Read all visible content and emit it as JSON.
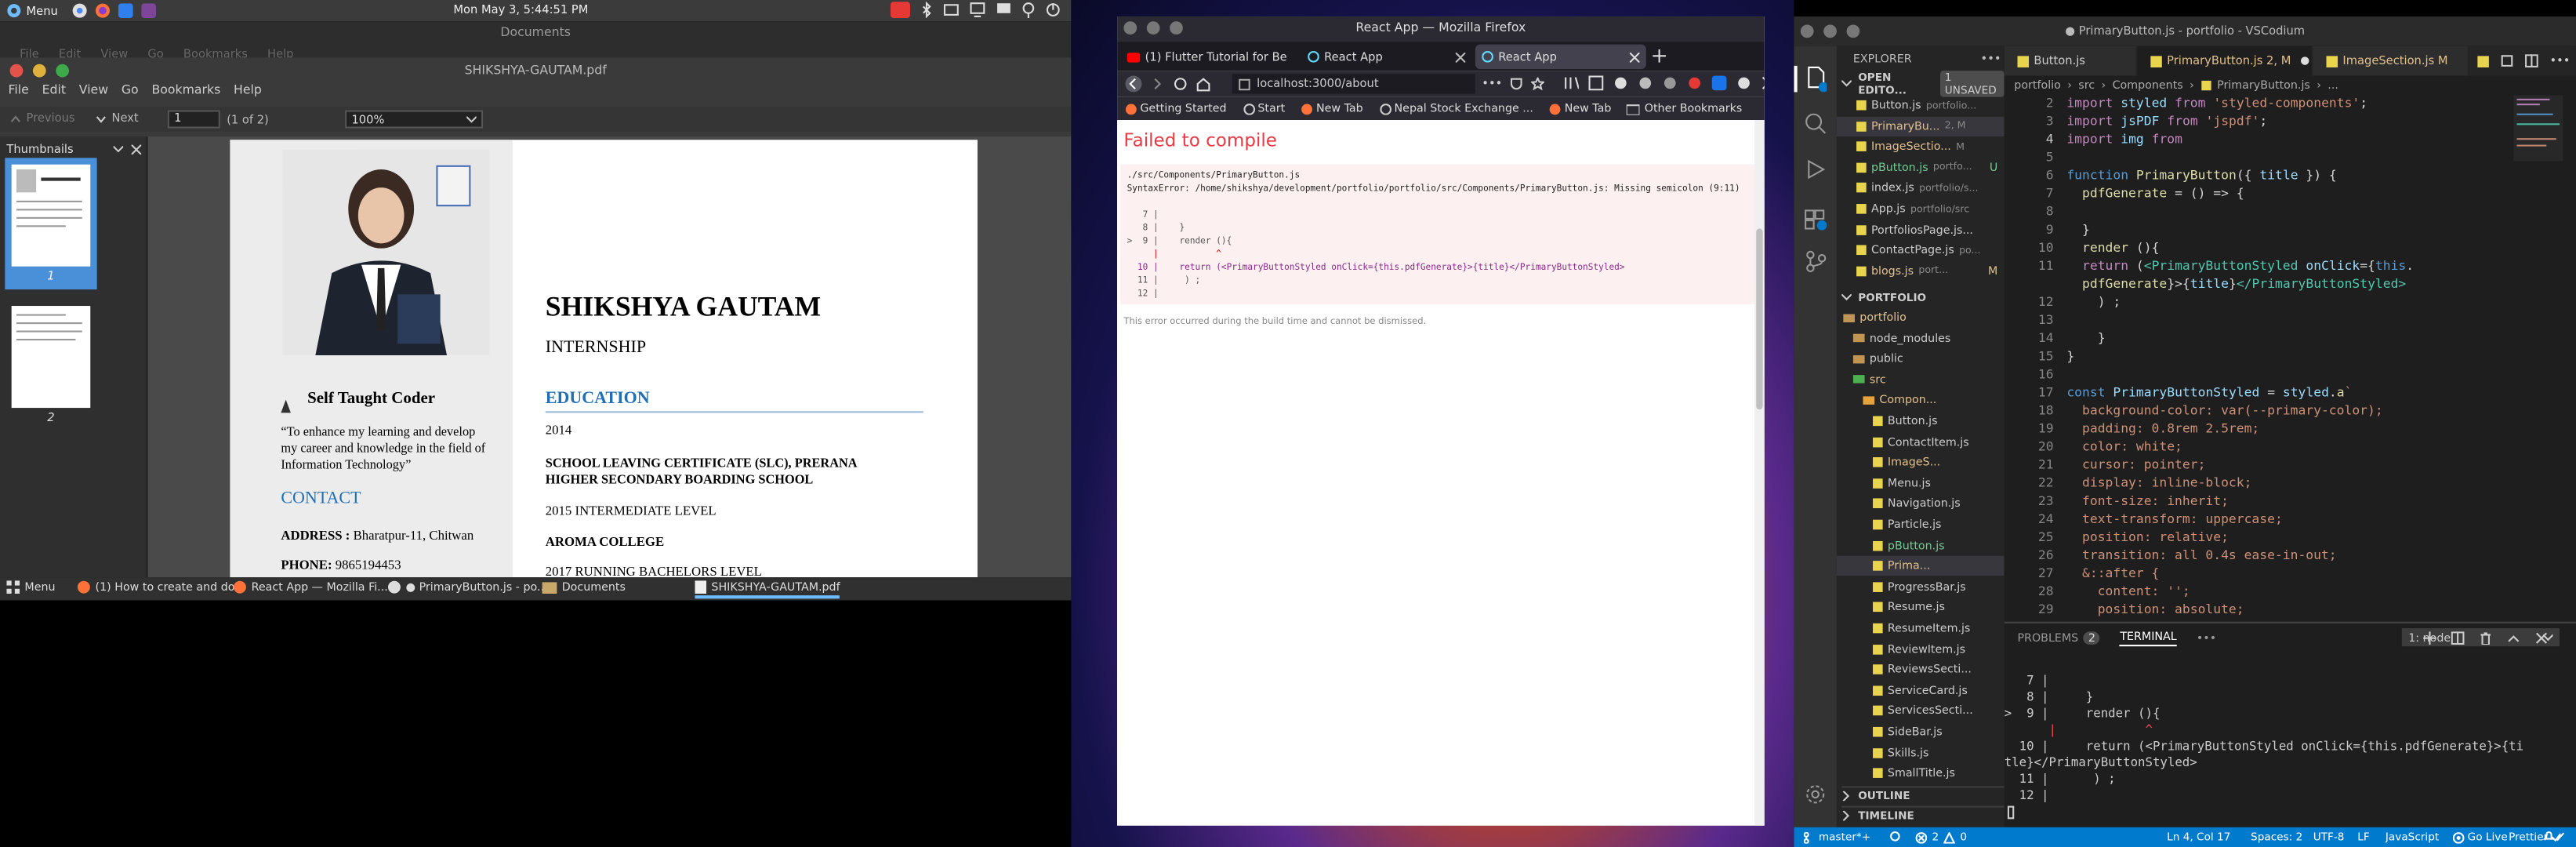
{
  "top_panel": {
    "menu_label": "Menu",
    "clock": "Mon May 3, 5:44:51 PM"
  },
  "pdf_viewer": {
    "window_label": "Documents",
    "title": "SHIKSHYA-GAUTAM.pdf",
    "ghost_menu": [
      "File",
      "Edit",
      "View",
      "Go",
      "Bookmarks",
      "Help"
    ],
    "menu": [
      "File",
      "Edit",
      "View",
      "Go",
      "Bookmarks",
      "Help"
    ],
    "previous_label": "Previous",
    "next_label": "Next",
    "page_value": "1",
    "page_count": "(1 of 2)",
    "zoom": "100%",
    "thumbnails_label": "Thumbnails",
    "thumb_pages": [
      "1",
      "2"
    ]
  },
  "resume": {
    "name": "SHIKSHYA GAUTAM",
    "position": "INTERNSHIP",
    "tagline": "Self Taught Coder",
    "quote": "“To enhance my learning and develop my career and knowledge in the field of Information Technology”",
    "contact_heading": "CONTACT",
    "address_label": "ADDRESS :",
    "address": "Bharatpur-11, Chitwan",
    "phone_label": "PHONE:",
    "phone": "9865194453",
    "education_heading": "EDUCATION",
    "edu_year1": "2014",
    "edu_cert1": "SCHOOL LEAVING CERTIFICATE (SLC), PRERANA HIGHER SECONDARY BOARDING SCHOOL",
    "edu_year2": "2015 INTERMEDIATE LEVEL",
    "edu_college": "AROMA COLLEGE",
    "edu_year3": "2017 RUNNING BACHELORS LEVEL"
  },
  "taskbar": {
    "menu_label": "Menu",
    "items": [
      "(1) How to create and do...",
      "React App — Mozilla Fi...",
      "● PrimaryButton.js - po...",
      "Documents",
      "SHIKSHYA-GAUTAM.pdf"
    ]
  },
  "firefox": {
    "title": "React App — Mozilla Firefox",
    "tabs": [
      "(1) Flutter Tutorial for Be",
      "React App",
      "React App"
    ],
    "url": "localhost:3000/about",
    "bookmarks": [
      "Getting Started",
      "Start",
      "New Tab",
      "Nepal Stock Exchange ...",
      "New Tab"
    ],
    "other_bookmarks": "Other Bookmarks",
    "error_title": "Failed to compile",
    "error_file": "./src/Components/PrimaryButton.js",
    "error_msg": "SyntaxError: /home/shikshya/development/portfolio/portfolio/src/Components/PrimaryButton.js: Missing semicolon (9:11)",
    "error_lines": [
      "   7 |",
      "   8 |    }",
      ">  9 |    render (){",
      "     |           ^",
      "  10 |    return (<PrimaryButtonStyled onClick={this.pdfGenerate}>{title}</PrimaryButtonStyled>",
      "  11 |     ) ;",
      "  12 |"
    ],
    "error_note": "This error occurred during the build time and cannot be dismissed."
  },
  "vscode": {
    "title": "● PrimaryButton.js - portfolio - VSCodium",
    "explorer_label": "EXPLORER",
    "open_editors": "OPEN EDITO...",
    "unsaved": "1 UNSAVED",
    "open_files": [
      {
        "name": "Button.js",
        "path": "portfolio...",
        "badge": ""
      },
      {
        "name": "PrimaryBu...",
        "path": "2, M",
        "badge": ""
      },
      {
        "name": "ImageSectio...",
        "path": "M",
        "badge": ""
      },
      {
        "name": "pButton.js",
        "path": "portfo...",
        "badge": "U"
      },
      {
        "name": "index.js",
        "path": "portfolio/s...",
        "badge": ""
      },
      {
        "name": "App.js",
        "path": "portfolio/src",
        "badge": ""
      },
      {
        "name": "PortfoliosPage.js...",
        "path": "",
        "badge": ""
      },
      {
        "name": "ContactPage.js",
        "path": "po...",
        "badge": ""
      },
      {
        "name": "blogs.js",
        "path": "port...",
        "badge": "M"
      }
    ],
    "portfolio_label": "PORTFOLIO",
    "tree": [
      "portfolio",
      "node_modules",
      "public",
      "src",
      "Compon...",
      "Button.js",
      "ContactItem.js",
      "ImageS...",
      "Menu.js",
      "Navigation.js",
      "Particle.js",
      "pButton.js",
      "Prima...",
      "ProgressBar.js",
      "Resume.js",
      "ResumeItem.js",
      "ReviewItem.js",
      "ReviewsSecti...",
      "ServiceCard.js",
      "ServicesSecti...",
      "SideBar.js",
      "Skills.js",
      "SmallTitle.js"
    ],
    "outline_label": "OUTLINE",
    "timeline_label": "TIMELINE",
    "editor_tabs": [
      "Button.js",
      "PrimaryButton.js 2, M",
      "ImageSection.js M"
    ],
    "breadcrumb": [
      "portfolio",
      "src",
      "Components",
      "PrimaryButton.js",
      "..."
    ],
    "code_line_numbers": [
      "2",
      "3",
      "4",
      "5",
      "6",
      "7",
      "8",
      "9",
      "10",
      "11",
      "",
      "12",
      "13",
      "14",
      "15",
      "16",
      "17",
      "18",
      "19",
      "20",
      "21",
      "22",
      "23",
      "24",
      "25",
      "26",
      "27",
      "28",
      "29"
    ],
    "panel_tabs": [
      "PROBLEMS",
      "TERMINAL"
    ],
    "problems_count": "2",
    "terminal_select": "1: node",
    "terminal_lines": [
      "   7 |",
      "   8 |     }",
      ">  9 |     render (){",
      "      |            ^",
      "  10 |     return (<PrimaryButtonStyled onClick={this.pdfGenerate}>{ti",
      "tle}</PrimaryButtonStyled>",
      "  11 |      ) ;",
      "  12 |"
    ],
    "status": {
      "branch": "master*+",
      "errors": "2",
      "warnings": "0",
      "cursor": "Ln 4, Col 17",
      "spaces": "Spaces: 2",
      "encoding": "UTF-8",
      "eol": "LF",
      "language": "JavaScript",
      "golive": "Go Live",
      "prettier": "Prettier"
    }
  },
  "colors": {
    "accent": "#007acc",
    "error": "#e83b46",
    "link_blue": "#1f6fb5",
    "git_modified": "#e2c08d",
    "git_untracked": "#73c991"
  }
}
